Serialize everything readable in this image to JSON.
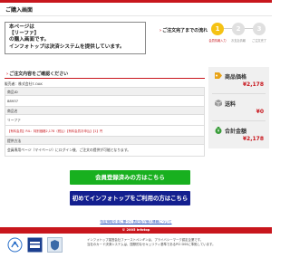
{
  "header": {
    "title": "ご購入画面"
  },
  "notice": {
    "lines": [
      "本ページは",
      "【リーファ】",
      "の購入画面です。",
      "インフォトップは決済システムを提供しています。"
    ]
  },
  "flow": {
    "label": "ご注文完了までの流れ",
    "steps": [
      {
        "number": "1",
        "label": "会員情報入力"
      },
      {
        "number": "2",
        "label": "お支払情報"
      },
      {
        "number": "3",
        "label": "ご注文完了"
      }
    ]
  },
  "order": {
    "section_title": "ご注文内容をご確認ください",
    "seller": "販売者：株式会社T-OAK",
    "product_id_header": "商品ID",
    "product_id": "88937",
    "product_name_header": "商品名",
    "product_name": "リーファ",
    "price_note": "【有料会員】RIL：特別価格2,178（税込）【有料会員お申込】【1】円",
    "delivery_header": "提供方法",
    "delivery_value": "会員専用ページ（マイページ）にログイン後、ご注文の提供が可能となります。"
  },
  "summary": {
    "price_label": "商品価格",
    "price_value": "¥2,178",
    "shipping_label": "送料",
    "shipping_value": "¥0",
    "total_label": "合計金額",
    "total_value": "¥2,178"
  },
  "buttons": {
    "member": "会員登録済みの方はこちら",
    "new_user": "初めてインフォトップをご利用の方はこちら"
  },
  "footer": {
    "link": "特定商取引法に基づく表記及び個人情報について",
    "copyright": "© 2005 Infotop",
    "text_lines": [
      "インフォトップ運営会社ファーストペンギンは、プライバシーマーク認定企業です。",
      "当社のカード決済システムは、国際的なセキュリティ基準であるPCI DSSに準拠しています。"
    ]
  },
  "colors": {
    "brand_red": "#c8161d",
    "member_button": "#18b01f",
    "new_user_button": "#131f8f",
    "active_step": "#f5c214"
  }
}
